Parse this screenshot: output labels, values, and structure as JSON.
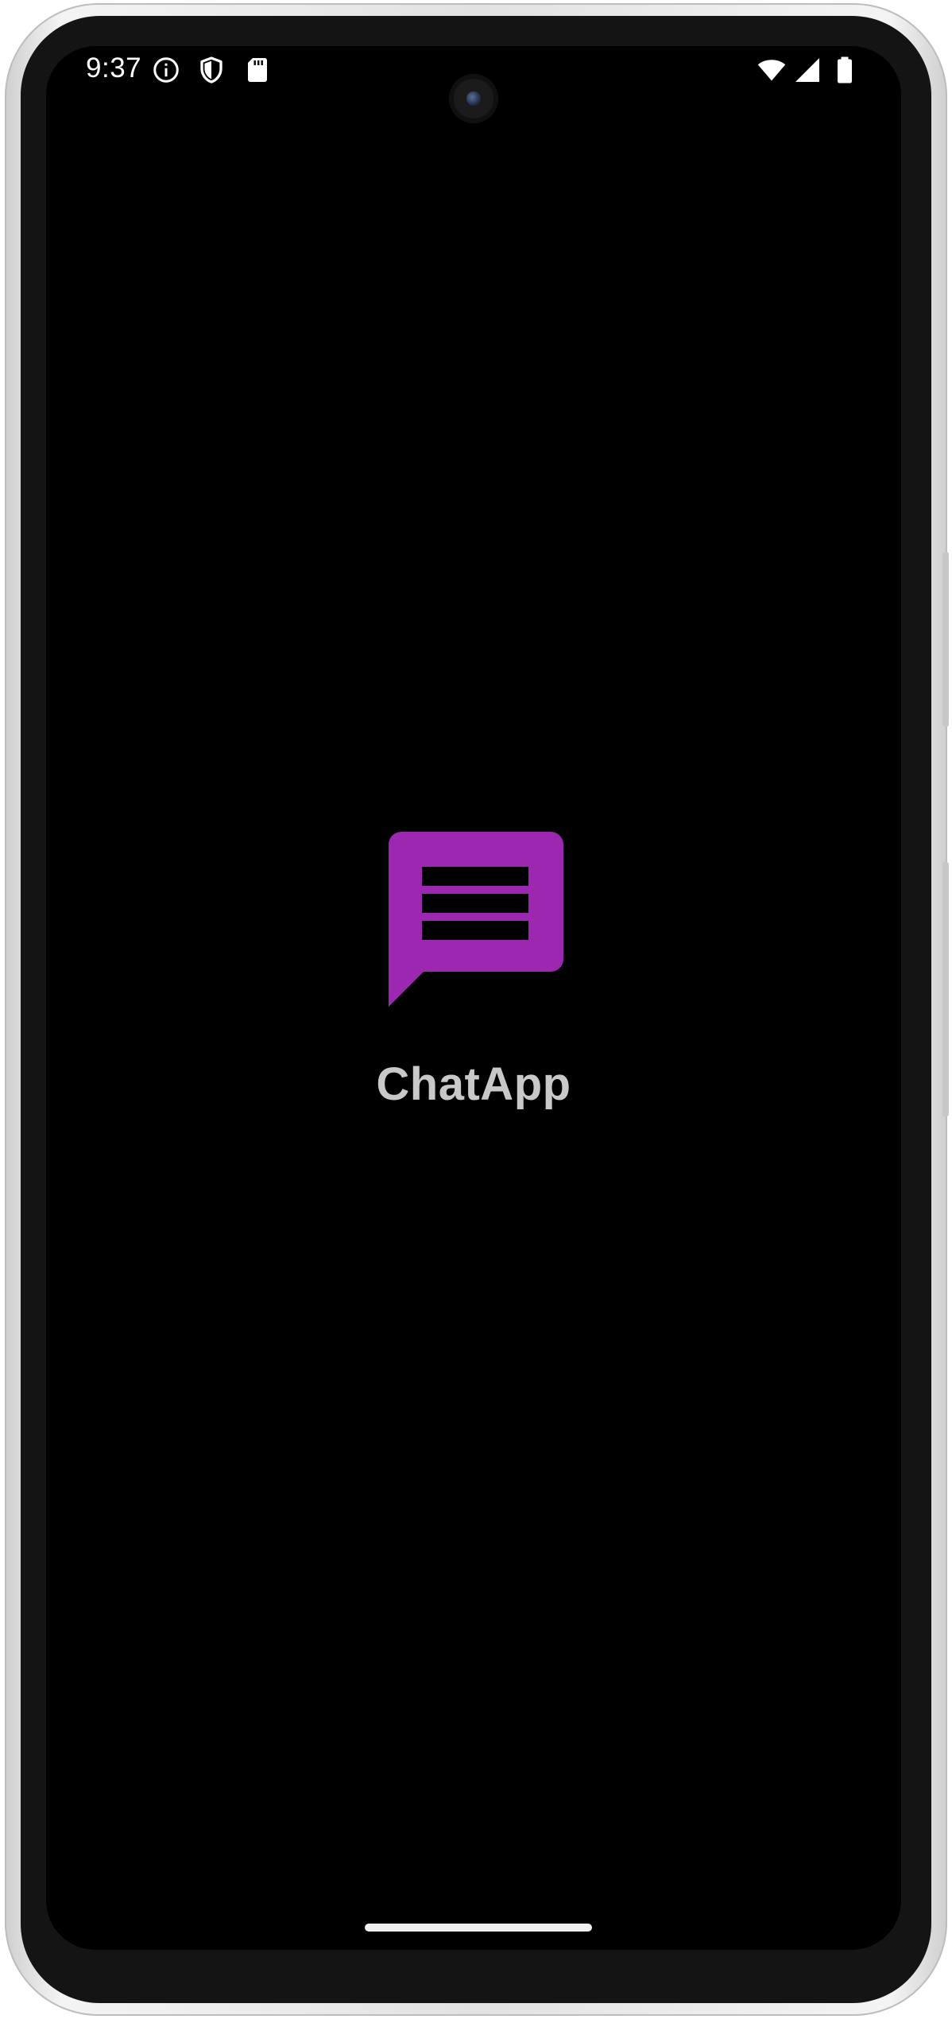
{
  "status_bar": {
    "time": "9:37",
    "left_icons": [
      "info-icon",
      "shield-icon",
      "sd-card-icon"
    ],
    "right_icons": [
      "wifi-icon",
      "cell-signal-icon",
      "battery-icon"
    ]
  },
  "splash": {
    "app_name": "ChatApp",
    "logo_icon": "chat-message-icon",
    "logo_color": "#9c27b0"
  },
  "colors": {
    "screen_background": "#000000",
    "title_text": "#c8c8c8",
    "nav_handle": "#f0f0f0"
  }
}
